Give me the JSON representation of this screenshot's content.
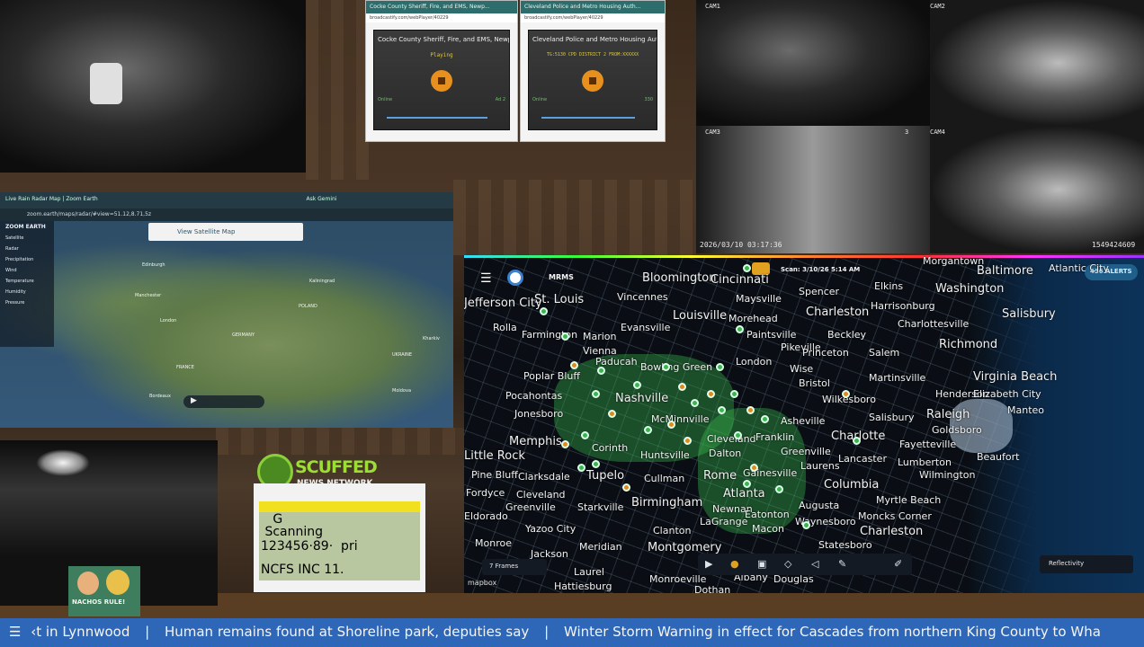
{
  "cams": {
    "cam1": "CAM1",
    "cam2": "CAM2",
    "cam3": "CAM3",
    "cam4": "CAM4",
    "cam2_num": "2",
    "cam3_num": "3",
    "timestamp": "2026/03/10 03:17:36",
    "id": "1549424609"
  },
  "radio_left": {
    "url": "broadcastify.com/webPlayer/40229",
    "title": "Cocke County Sheriff, Fire, and EMS, Newp...",
    "status": "Playing",
    "left": "Online",
    "right": "Ad 2"
  },
  "radio_right": {
    "url": "broadcastify.com/webPlayer/40229",
    "title": "Cleveland Police and Metro Housing Auth...",
    "status": "TG:5130 CPD DISTRICT 2 FROM:XXXXXX",
    "left": "Online",
    "right": "330"
  },
  "zoom": {
    "tab1": "Live Rain Radar Map | Zoom Earth",
    "tab2": "Ask Gemini",
    "url": "zoom.earth/maps/radar/#view=51.12,8.71,5z",
    "logo": "ZOOM EARTH",
    "sat_btn": "View Satellite Map",
    "menu": [
      "Satellite",
      "Radar",
      "Precipitation",
      "Wind",
      "Temperature",
      "Humidity",
      "Pressure"
    ],
    "places": [
      "Edinburgh",
      "Manchester",
      "London",
      "POLAND",
      "Kaliningrad",
      "GERMANY",
      "FRANCE",
      "UKRAINE",
      "Moldova",
      "Bordeaux",
      "Kharkiv"
    ]
  },
  "scuffed": {
    "line1": "SCUFFED",
    "line2": "NEWS NETWORK"
  },
  "scanner": {
    "l1": "   G      ",
    "l2": " Scanning ",
    "l3": "123456·89·  pri",
    "l4": "NCFS INC 11."
  },
  "nachos": "NACHOS RULE!",
  "radar": {
    "product": "MRMS",
    "scan": "Scan: 3/10/26 5:14 AM",
    "alerts": "436 ALERTS",
    "frames": "7 Frames",
    "layer": "Reflectivity",
    "credit": "mapbox",
    "cities": [
      {
        "n": "Bloomington"
      },
      {
        "n": "Cincinnati"
      },
      {
        "n": "St. Louis"
      },
      {
        "n": "Vincennes"
      },
      {
        "n": "Maysville"
      },
      {
        "n": "Spencer"
      },
      {
        "n": "Elkins"
      },
      {
        "n": "Baltimore"
      },
      {
        "n": "Washington"
      },
      {
        "n": "Louisville"
      },
      {
        "n": "Morehead"
      },
      {
        "n": "Charleston"
      },
      {
        "n": "Harrisonburg"
      },
      {
        "n": "Salisbury"
      },
      {
        "n": "Evansville"
      },
      {
        "n": "Charlottesville"
      },
      {
        "n": "Rolla"
      },
      {
        "n": "Farmington"
      },
      {
        "n": "Marion"
      },
      {
        "n": "Richmond"
      },
      {
        "n": "Paintsville"
      },
      {
        "n": "Pikeville"
      },
      {
        "n": "Beckley"
      },
      {
        "n": "Vienna"
      },
      {
        "n": "Paducah"
      },
      {
        "n": "London"
      },
      {
        "n": "Princeton"
      },
      {
        "n": "Salem"
      },
      {
        "n": "Bowling Green"
      },
      {
        "n": "Wise"
      },
      {
        "n": "Martinsville"
      },
      {
        "n": "Virginia Beach"
      },
      {
        "n": "Poplar Bluff"
      },
      {
        "n": "Bristol"
      },
      {
        "n": "Henderson"
      },
      {
        "n": "Elizabeth City"
      },
      {
        "n": "Pocahontas"
      },
      {
        "n": "Nashville"
      },
      {
        "n": "Wilkesboro"
      },
      {
        "n": "Manteo"
      },
      {
        "n": "Jonesboro"
      },
      {
        "n": "McMinnville"
      },
      {
        "n": "Asheville"
      },
      {
        "n": "Salisbury"
      },
      {
        "n": "Raleigh"
      },
      {
        "n": "Memphis"
      },
      {
        "n": "Goldsboro"
      },
      {
        "n": "Corinth"
      },
      {
        "n": "Cleveland"
      },
      {
        "n": "Franklin"
      },
      {
        "n": "Charlotte"
      },
      {
        "n": "Fayetteville"
      },
      {
        "n": "Little Rock"
      },
      {
        "n": "Huntsville"
      },
      {
        "n": "Dalton"
      },
      {
        "n": "Greenville"
      },
      {
        "n": "Lancaster"
      },
      {
        "n": "Lumberton"
      },
      {
        "n": "Beaufort"
      },
      {
        "n": "Pine Bluff"
      },
      {
        "n": "Clarksdale"
      },
      {
        "n": "Tupelo"
      },
      {
        "n": "Cullman"
      },
      {
        "n": "Rome"
      },
      {
        "n": "Gainesville"
      },
      {
        "n": "Laurens"
      },
      {
        "n": "Wilmington"
      },
      {
        "n": "Fordyce"
      },
      {
        "n": "Cleveland"
      },
      {
        "n": "Atlanta"
      },
      {
        "n": "Columbia"
      },
      {
        "n": "Greenville"
      },
      {
        "n": "Starkville"
      },
      {
        "n": "Birmingham"
      },
      {
        "n": "Newnan"
      },
      {
        "n": "Augusta"
      },
      {
        "n": "Myrtle Beach"
      },
      {
        "n": "Eldorado"
      },
      {
        "n": "Eatonton"
      },
      {
        "n": "Waynesboro"
      },
      {
        "n": "Moncks Corner"
      },
      {
        "n": "Yazoo City"
      },
      {
        "n": "Clanton"
      },
      {
        "n": "LaGrange"
      },
      {
        "n": "Charleston"
      },
      {
        "n": "Monroe"
      },
      {
        "n": "Jackson"
      },
      {
        "n": "Meridian"
      },
      {
        "n": "Montgomery"
      },
      {
        "n": "Macon"
      },
      {
        "n": "Statesboro"
      },
      {
        "n": "Laurel"
      },
      {
        "n": "Monroeville"
      },
      {
        "n": "Albany"
      },
      {
        "n": "Douglas"
      },
      {
        "n": "Hattiesburg"
      },
      {
        "n": "Dothan"
      },
      {
        "n": "Morgantown"
      },
      {
        "n": "Atlantic City"
      },
      {
        "n": "Jefferson City"
      }
    ]
  },
  "ticker": {
    "items": [
      "‹t in Lynnwood",
      "Human remains found at Shoreline park, deputies say",
      "Winter Storm Warning in effect for Cascades from northern King County to Wha"
    ],
    "sep": "|",
    "menu_icon": "hamburger-icon"
  },
  "colors": {
    "ticker_bg": "#2f67b8",
    "scuffed_green": "#9cde34",
    "radar_bg": "#0a0e14"
  }
}
